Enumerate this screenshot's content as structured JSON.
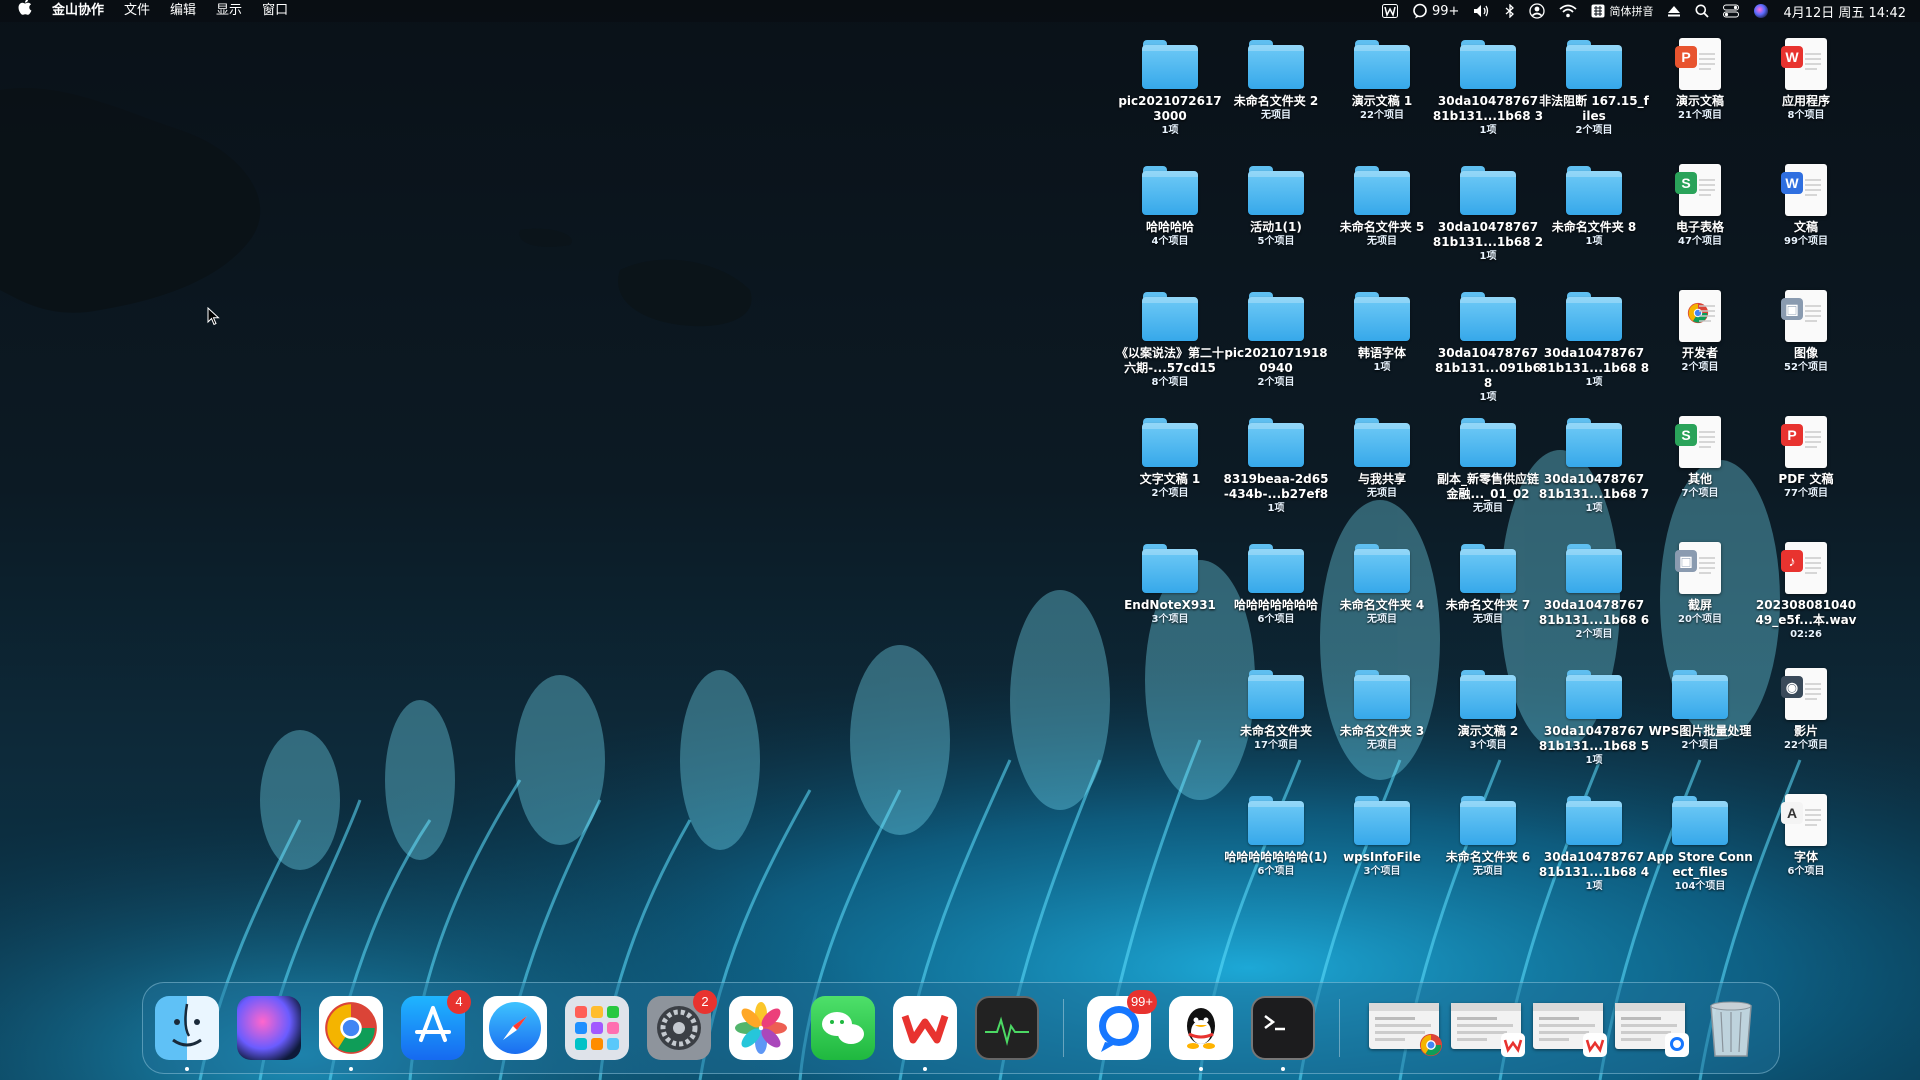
{
  "menubar": {
    "apple_icon": "apple-logo-icon",
    "app_name": "金山协作",
    "menus": [
      "文件",
      "编辑",
      "显示",
      "窗口"
    ],
    "status": {
      "wps_icon": "wps-status-icon",
      "messages_badge": "99+",
      "input_method": "简体拼音",
      "datetime": "4月12日 周五 14:42"
    }
  },
  "desktop": {
    "items": [
      {
        "name": "pic2021072617 3000",
        "sub": "1项",
        "kind": "folder"
      },
      {
        "name": "未命名文件夹 2",
        "sub": "无项目",
        "kind": "folder"
      },
      {
        "name": "演示文稿 1",
        "sub": "22个项目",
        "kind": "folder"
      },
      {
        "name": "30da10478767 81b131...1b68 3",
        "sub": "1项",
        "kind": "folder"
      },
      {
        "name": "非法阻断 167.15_files",
        "sub": "2个项目",
        "kind": "folder"
      },
      {
        "name": "演示文稿",
        "sub": "21个项目",
        "kind": "ppt"
      },
      {
        "name": "应用程序",
        "sub": "8个项目",
        "kind": "wps-app"
      },
      {
        "name": "哈哈哈哈",
        "sub": "4个项目",
        "kind": "folder"
      },
      {
        "name": "活动1(1)",
        "sub": "5个项目",
        "kind": "folder"
      },
      {
        "name": "未命名文件夹 5",
        "sub": "无项目",
        "kind": "folder"
      },
      {
        "name": "30da10478767 81b131...1b68 2",
        "sub": "1项",
        "kind": "folder"
      },
      {
        "name": "未命名文件夹 8",
        "sub": "1项",
        "kind": "folder"
      },
      {
        "name": "电子表格",
        "sub": "47个项目",
        "kind": "sheet"
      },
      {
        "name": "文稿",
        "sub": "99个项目",
        "kind": "word"
      },
      {
        "name": "《以案说法》第二十六期-...57cd15",
        "sub": "8个项目",
        "kind": "folder"
      },
      {
        "name": "pic2021071918 0940",
        "sub": "2个项目",
        "kind": "folder"
      },
      {
        "name": "韩语字体",
        "sub": "1项",
        "kind": "folder"
      },
      {
        "name": "30da10478767 81b131...091b68",
        "sub": "1项",
        "kind": "folder"
      },
      {
        "name": "30da10478767 81b131...1b68 8",
        "sub": "1项",
        "kind": "folder"
      },
      {
        "name": "开发者",
        "sub": "2个项目",
        "kind": "chrome-doc"
      },
      {
        "name": "图像",
        "sub": "52个项目",
        "kind": "jpeg"
      },
      {
        "name": "文字文稿 1",
        "sub": "2个项目",
        "kind": "folder"
      },
      {
        "name": "8319beaa-2d65 -434b-...b27ef8",
        "sub": "1项",
        "kind": "folder"
      },
      {
        "name": "与我共享",
        "sub": "无项目",
        "kind": "folder"
      },
      {
        "name": "副本_新零售供应链金融..._01_02",
        "sub": "无项目",
        "kind": "folder"
      },
      {
        "name": "30da10478767 81b131...1b68 7",
        "sub": "1项",
        "kind": "folder"
      },
      {
        "name": "其他",
        "sub": "7个项目",
        "kind": "sheet"
      },
      {
        "name": "PDF 文稿",
        "sub": "77个项目",
        "kind": "pdf"
      },
      {
        "name": "EndNoteX931",
        "sub": "3个项目",
        "kind": "folder"
      },
      {
        "name": "哈哈哈哈哈哈哈",
        "sub": "6个项目",
        "kind": "folder"
      },
      {
        "name": "未命名文件夹 4",
        "sub": "无项目",
        "kind": "folder"
      },
      {
        "name": "未命名文件夹 7",
        "sub": "无项目",
        "kind": "folder"
      },
      {
        "name": "30da10478767 81b131...1b68 6",
        "sub": "2个项目",
        "kind": "folder"
      },
      {
        "name": "截屏",
        "sub": "20个项目",
        "kind": "png"
      },
      {
        "name": "202308081040 49_e5f...本.wav",
        "sub": "02:26",
        "kind": "wav"
      },
      {
        "name": "未命名文件夹",
        "sub": "17个项目",
        "kind": "folder"
      },
      {
        "name": "未命名文件夹 3",
        "sub": "无项目",
        "kind": "folder"
      },
      {
        "name": "演示文稿 2",
        "sub": "3个项目",
        "kind": "folder"
      },
      {
        "name": "30da10478767 81b131...1b68 5",
        "sub": "1项",
        "kind": "folder"
      },
      {
        "name": "WPS图片批量处理",
        "sub": "2个项目",
        "kind": "folder"
      },
      {
        "name": "影片",
        "sub": "22个项目",
        "kind": "mp4"
      },
      {
        "name": "哈哈哈哈哈哈哈(1)",
        "sub": "6个项目",
        "kind": "folder"
      },
      {
        "name": "wpsInfoFile",
        "sub": "3个项目",
        "kind": "folder"
      },
      {
        "name": "未命名文件夹 6",
        "sub": "无项目",
        "kind": "folder"
      },
      {
        "name": "30da10478767 81b131...1b68 4",
        "sub": "1项",
        "kind": "folder"
      },
      {
        "name": "App Store Connect_files",
        "sub": "104个项目",
        "kind": "folder"
      },
      {
        "name": "字体",
        "sub": "6个项目",
        "kind": "font"
      }
    ]
  },
  "dock": {
    "apps": [
      {
        "name": "finder-icon",
        "badge": ""
      },
      {
        "name": "siri-icon",
        "badge": ""
      },
      {
        "name": "chrome-icon",
        "badge": ""
      },
      {
        "name": "app-store-icon",
        "badge": "4"
      },
      {
        "name": "safari-icon",
        "badge": ""
      },
      {
        "name": "launchpad-icon",
        "badge": ""
      },
      {
        "name": "system-settings-icon",
        "badge": "2"
      },
      {
        "name": "photos-icon",
        "badge": ""
      },
      {
        "name": "wechat-icon",
        "badge": ""
      },
      {
        "name": "wps-icon",
        "badge": ""
      },
      {
        "name": "activity-monitor-icon",
        "badge": ""
      },
      {
        "name": "messages-icon",
        "badge": "99+"
      },
      {
        "name": "qq-icon",
        "badge": ""
      },
      {
        "name": "terminal-icon",
        "badge": ""
      }
    ],
    "minimized": [
      "chrome-window-thumb",
      "wps-window-thumb-1",
      "wps-window-thumb-2",
      "finder-window-thumb"
    ],
    "trash": "trash-icon"
  },
  "colors": {
    "folder": "#45b3ee",
    "badge": "#e8332f",
    "wps_red": "#e8332f"
  }
}
